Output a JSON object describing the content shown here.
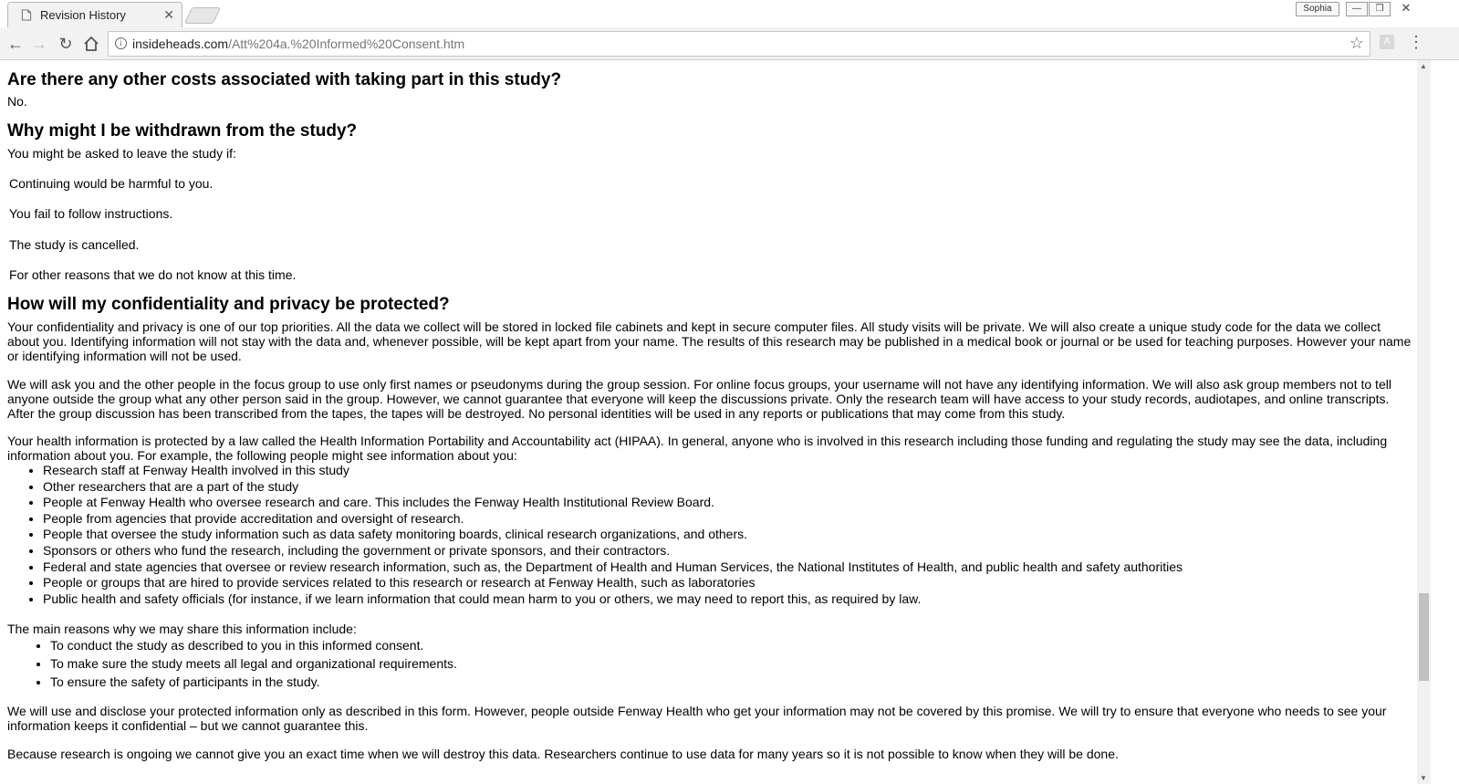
{
  "browser": {
    "tab_title": "Revision History",
    "tab_close": "✕",
    "profile_name": "Sophia",
    "url_host": "insideheads.com",
    "url_path": "/Att%204a.%20Informed%20Consent.htm"
  },
  "document": {
    "heading_costs": "Are there any other costs associated with taking part in this study?",
    "costs_answer": "No.",
    "heading_withdrawn": "Why might I be withdrawn from the study?",
    "withdrawn_intro": "You might be asked to leave the study if:",
    "withdraw_reasons": [
      "Continuing would be harmful to you.",
      "You fail to follow instructions.",
      "The study is cancelled.",
      "For other reasons that we do not know at this time."
    ],
    "heading_confidentiality": "How will my confidentiality and privacy be protected?",
    "para1": "Your confidentiality and privacy is one of our top priorities. All the data we collect will be stored in locked file cabinets and kept in secure computer files. All study visits will be private. We will also create a unique study code for the data we collect about you. Identifying information will not stay with the data and, whenever possible, will be kept apart from your name. The results of this research may be published in a medical book or journal or be used for teaching purposes. However your name or identifying information will not be used.",
    "para2": "We will ask you and the other people in the focus group to use only first names or pseudonyms during the group session. For online focus groups, your username will not have any identifying information. We will also ask group members not to tell anyone outside the group what any other person said in the group.  However, we cannot guarantee that everyone will keep the discussions private.  Only the research team will have access to your study records, audiotapes, and online transcripts.  After the group discussion has been transcribed from the tapes, the tapes will be destroyed.  No personal identities will be used in any reports or publications that may come from this study.",
    "para3": "Your health information is protected by a law called the Health Information Portability and Accountability act (HIPAA). In general, anyone who is involved in this research including those funding and regulating the study may see the data, including information about you.  For example, the following people might see information about you:",
    "people_list": [
      "Research staff at Fenway Health involved in this study",
      "Other researchers that are a part of the study",
      "People at Fenway Health who oversee research and care. This includes the Fenway Health Institutional Review Board.",
      "People from agencies that provide accreditation and oversight of research.",
      "People that oversee the study information such as data safety monitoring boards, clinical research organizations, and others.",
      "Sponsors or others who fund the research, including the government or private sponsors, and their contractors.",
      "Federal and state agencies that oversee or review research information, such as, the Department of Health and Human Services, the National Institutes of Health, and public health and safety authorities",
      "People or groups that are hired to provide services related to this research or research at Fenway Health, such as laboratories",
      "Public health and safety officials (for instance, if we learn information that could mean harm to you or others, we may need to report this, as required by law."
    ],
    "main_reasons_intro": "The main reasons why we may share this information include:",
    "main_reasons": [
      "To conduct the study as described to you in this informed consent.",
      "To make sure the study meets all legal and organizational requirements.",
      "To ensure the safety of participants in the study."
    ],
    "para4": "We will use and disclose your protected information only as described in this form. However, people outside Fenway Health who get your information may not be covered by this promise.  We will try to ensure that everyone who needs to see your information keeps it confidential – but we cannot guarantee this.",
    "para5": "Because research is ongoing we cannot give you an exact time when we will destroy this data.  Researchers continue to use data for many years so it is not possible to know when they will be done."
  },
  "icons": {
    "back": "arrow-left-icon",
    "forward": "arrow-right-icon",
    "reload": "reload-icon",
    "home": "home-icon",
    "info": "info-icon",
    "bookmark": "star-icon",
    "menu": "kebab-menu-icon"
  },
  "scroll_position": 0.86
}
